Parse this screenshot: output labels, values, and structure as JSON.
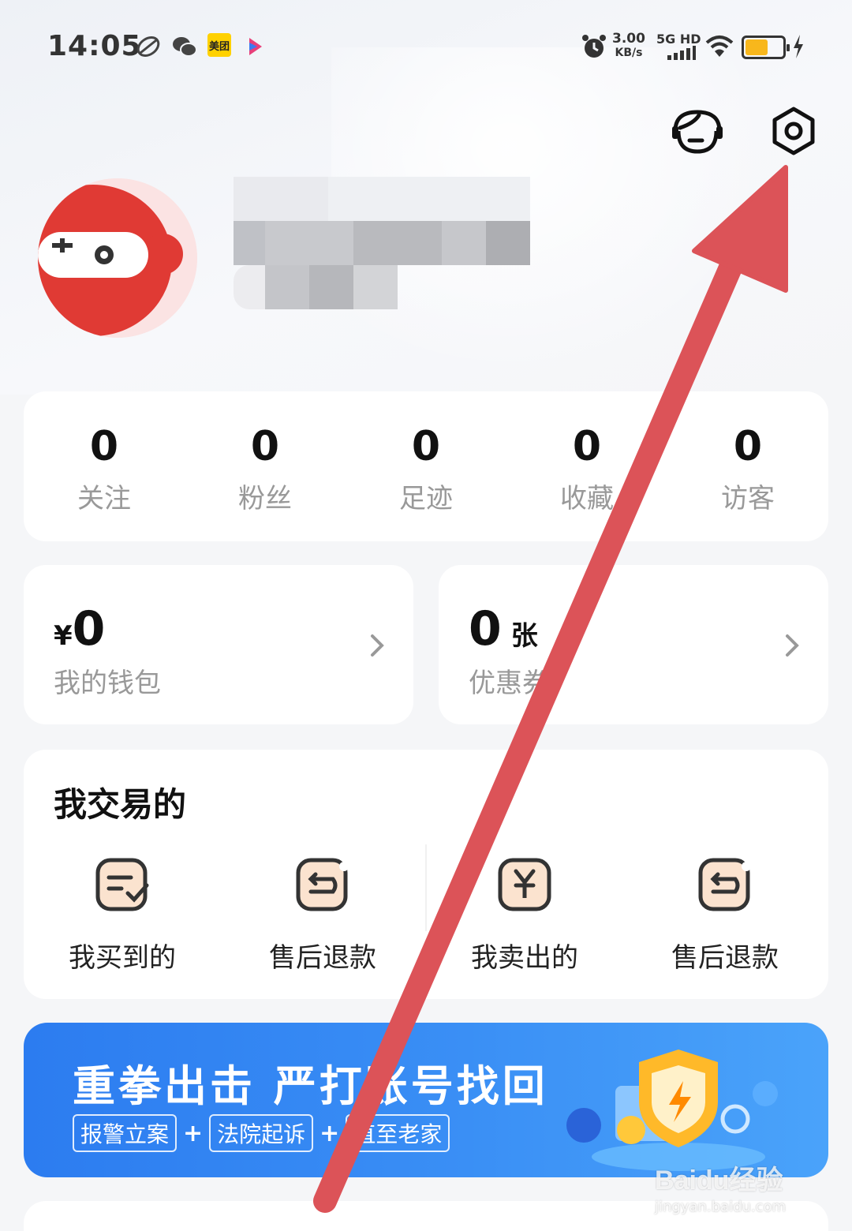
{
  "status_bar": {
    "time": "14:05",
    "meituan_label": "美团",
    "net_speed_value": "3.00",
    "net_speed_unit": "KB/s",
    "network_label": "5G HD",
    "battery_color": "#f8b71c"
  },
  "header": {
    "service_icon": "customer-service-icon",
    "settings_icon": "settings-icon"
  },
  "profile": {
    "avatar_icon": "gamepad-ninja-avatar",
    "avatar_color": "#e03a34"
  },
  "stats": [
    {
      "value": "0",
      "label": "关注"
    },
    {
      "value": "0",
      "label": "粉丝"
    },
    {
      "value": "0",
      "label": "足迹"
    },
    {
      "value": "0",
      "label": "收藏"
    },
    {
      "value": "0",
      "label": "访客"
    }
  ],
  "wallet": {
    "unit": "¥",
    "value": "0",
    "label": "我的钱包"
  },
  "coupon": {
    "value": "0",
    "unit": "张",
    "label": "优惠券"
  },
  "trade": {
    "title": "我交易的",
    "items": [
      {
        "label": "我买到的",
        "icon": "bought-list-icon"
      },
      {
        "label": "售后退款",
        "icon": "refund-icon"
      },
      {
        "label": "我卖出的",
        "icon": "sold-yen-icon"
      },
      {
        "label": "售后退款",
        "icon": "refund-icon"
      }
    ]
  },
  "banner": {
    "title": "重拳出击 严打账号找回",
    "tags": [
      "报警立案",
      "法院起诉",
      "直至老家"
    ],
    "plus": "+",
    "bg_color": "#3a8ff5"
  },
  "watermark": {
    "main": "Baidu经验",
    "url": "jingyan.baidu.com"
  },
  "annotation": {
    "arrow_color": "#dc5358"
  }
}
